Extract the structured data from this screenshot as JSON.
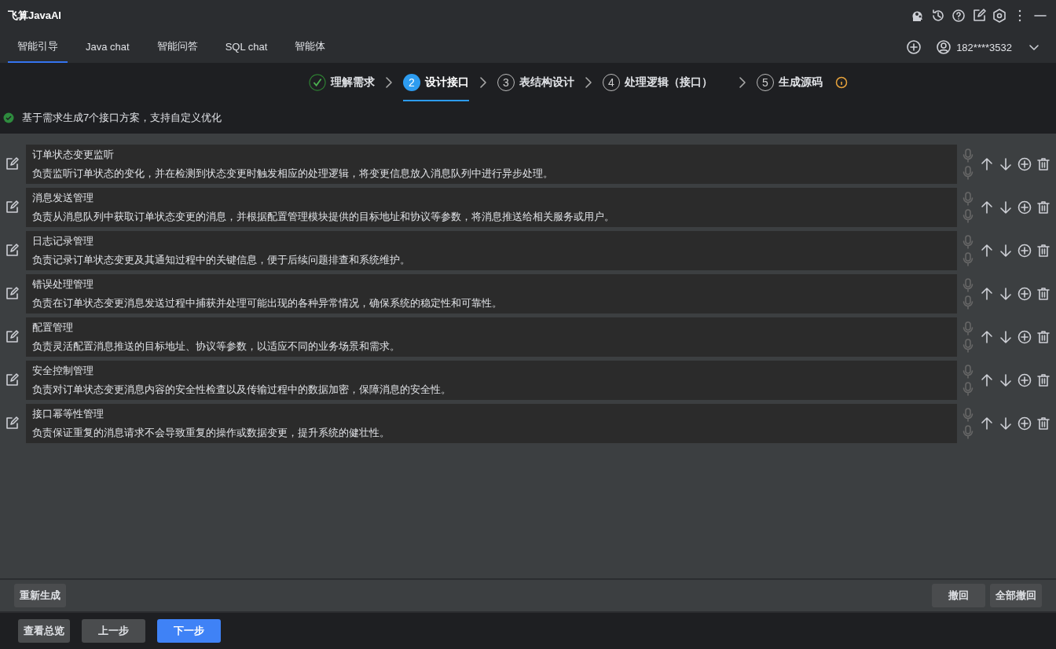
{
  "window": {
    "title": "飞算JavaAI"
  },
  "tabs": [
    {
      "label": "智能引导",
      "selected": true
    },
    {
      "label": "Java chat",
      "selected": false
    },
    {
      "label": "智能问答",
      "selected": false
    },
    {
      "label": "SQL chat",
      "selected": false
    },
    {
      "label": "智能体",
      "selected": false
    }
  ],
  "account": {
    "user": "182****3532"
  },
  "steps": [
    {
      "label": "理解需求",
      "completed": true,
      "selected": false
    },
    {
      "number": "2",
      "label": "设计接口",
      "completed": false,
      "selected": true
    },
    {
      "number": "3",
      "label": "表结构设计",
      "completed": false,
      "selected": false
    },
    {
      "number": "4",
      "label": "处理逻辑（接口）",
      "completed": false,
      "selected": false
    },
    {
      "number": "5",
      "label": "生成源码",
      "completed": false,
      "selected": false
    }
  ],
  "message": "基于需求生成7个接口方案，支持自定义优化",
  "interfaces": [
    {
      "title": "订单状态变更监听",
      "description": "负责监听订单状态的变化，并在检测到状态变更时触发相应的处理逻辑，将变更信息放入消息队列中进行异步处理。"
    },
    {
      "title": "消息发送管理",
      "description": "负责从消息队列中获取订单状态变更的消息，并根据配置管理模块提供的目标地址和协议等参数，将消息推送给相关服务或用户。"
    },
    {
      "title": "日志记录管理",
      "description": "负责记录订单状态变更及其通知过程中的关键信息，便于后续问题排查和系统维护。"
    },
    {
      "title": "错误处理管理",
      "description": "负责在订单状态变更消息发送过程中捕获并处理可能出现的各种异常情况，确保系统的稳定性和可靠性。"
    },
    {
      "title": "配置管理",
      "description": "负责灵活配置消息推送的目标地址、协议等参数，以适应不同的业务场景和需求。"
    },
    {
      "title": "安全控制管理",
      "description": "负责对订单状态变更消息内容的安全性检查以及传输过程中的数据加密，保障消息的安全性。"
    },
    {
      "title": "接口幂等性管理",
      "description": "负责保证重复的消息请求不会导致重复的操作或数据变更，提升系统的健壮性。"
    }
  ],
  "action_bar": {
    "regenerate": "重新生成",
    "undo": "撤回",
    "undo_all": "全部撤回"
  },
  "footer": {
    "overview": "查看总览",
    "previous": "上一步",
    "next": "下一步"
  }
}
